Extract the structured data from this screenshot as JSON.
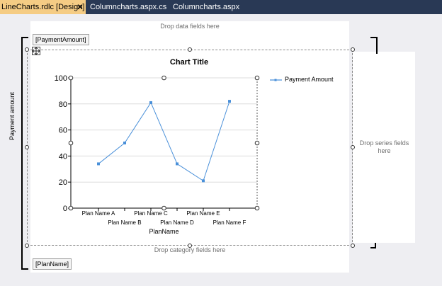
{
  "tabs": [
    {
      "label": "LineCharts.rdlc [Design]",
      "close": "✕",
      "active": true
    },
    {
      "label": "Columncharts.aspx.cs",
      "active": false
    },
    {
      "label": "Columncharts.aspx",
      "active": false
    }
  ],
  "designer": {
    "drop_data_hint": "Drop data fields here",
    "drop_series_hint": "Drop series fields here",
    "drop_category_hint": "Drop category fields here",
    "data_field_label": "[PaymentAmount]",
    "category_field_label": "[PlanName]"
  },
  "colors": {
    "tab_bar": "#293955",
    "active_tab": "#f5cc84",
    "series_line": "#4a90d9",
    "designer_bg": "#eeeef2"
  },
  "chart_data": {
    "type": "line",
    "title": "Chart Title",
    "xlabel": "PlanName",
    "ylabel": "Payment amount",
    "ylim": [
      0,
      100
    ],
    "yticks": [
      0,
      20,
      40,
      60,
      80,
      100
    ],
    "grid": true,
    "legend_position": "right",
    "categories": [
      "Plan Name A",
      "Plan Name B",
      "Plan Name C",
      "Plan Name D",
      "Plan Name E",
      "Plan Name F"
    ],
    "series": [
      {
        "name": "Payment Amount",
        "values": [
          34,
          50,
          81,
          34,
          21,
          82
        ]
      }
    ]
  }
}
